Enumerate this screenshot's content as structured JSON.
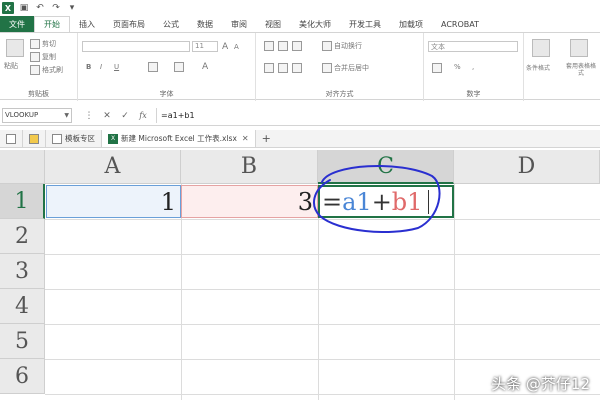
{
  "ribbon": {
    "tabs": [
      "文件",
      "开始",
      "插入",
      "页面布局",
      "公式",
      "数据",
      "审阅",
      "视图",
      "美化大师",
      "开发工具",
      "加载项",
      "ACROBAT"
    ],
    "clipboard": {
      "paste": "粘贴",
      "cut": "剪切",
      "copy": "复制",
      "format_painter": "格式刷",
      "label": "剪贴板"
    },
    "font": {
      "size": "11",
      "bold": "B",
      "italic": "I",
      "underline": "U",
      "label": "字体"
    },
    "alignment": {
      "wrap": "自动换行",
      "merge": "合并后居中",
      "label": "对齐方式"
    },
    "number": {
      "format": "文本",
      "percent": "%",
      "comma": ",",
      "label": "数字"
    },
    "styles": {
      "conditional": "条件格式",
      "table": "套用表格格式"
    }
  },
  "formula_bar": {
    "name_box": "VLOOKUP",
    "cancel": "✕",
    "enter": "✓",
    "fx": "fx",
    "formula": "=a1+b1"
  },
  "doc_tabs": [
    {
      "label": "模板专区"
    },
    {
      "label": "新建 Microsoft Excel 工作表.xlsx"
    }
  ],
  "grid": {
    "columns": [
      "A",
      "B",
      "C",
      "D"
    ],
    "rows": [
      "1",
      "2",
      "3",
      "4",
      "5",
      "6"
    ],
    "a1": "1",
    "b1": "3",
    "c1": {
      "eq": "=",
      "ref1": "a1",
      "op": "+",
      "ref2": "b1"
    }
  },
  "watermark": "头条 @芥仔12",
  "colors": {
    "excel_green": "#217346",
    "ref_blue": "#4a86d6",
    "ref_red": "#e06a6a",
    "ink": "#2a2fd0"
  }
}
